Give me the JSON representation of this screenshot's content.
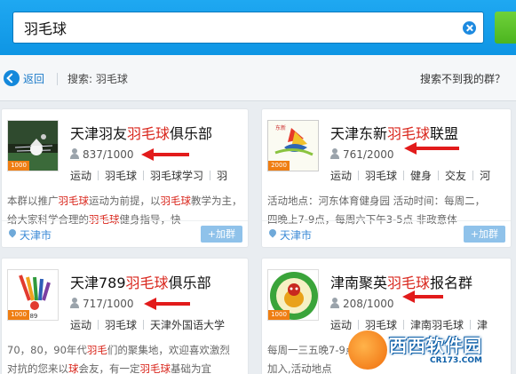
{
  "search": {
    "query": "羽毛球"
  },
  "nav": {
    "back": "返回",
    "search_label": "搜索: 羽毛球",
    "not_found": "搜索不到我的群？"
  },
  "colors": {
    "accent": "#0e95e4",
    "highlight": "#d9261c",
    "badge": "#ef7e13",
    "join": "#8fc2ea"
  },
  "groups": [
    {
      "title_pre": "天津羽友",
      "title_hl": "羽毛球",
      "title_post": "俱乐部",
      "members": "837/1000",
      "badge": "1000",
      "tags": [
        "运动",
        "羽毛球",
        "羽毛球学习",
        "羽"
      ],
      "desc1_a": "本群以推广",
      "desc1_hl1": "羽毛球",
      "desc1_b": "运动为前提，以",
      "desc1_hl2": "羽毛球",
      "desc1_c": "教学为主，",
      "desc2_a": "给大家科学合理的",
      "desc2_hl": "羽毛球",
      "desc2_b": "健身指导，快",
      "location": "天津市",
      "join": "+加群"
    },
    {
      "title_pre": "天津东新",
      "title_hl": "羽毛球",
      "title_post": "联盟",
      "members": "761/2000",
      "badge": "2000",
      "tags": [
        "运动",
        "羽毛球",
        "健身",
        "交友",
        "河"
      ],
      "desc1": "活动地点：河东体育健身园 活动时间：每周二，",
      "desc2": "四晚上7-9点，每周六下午3-5点 非政意体",
      "location": "天津市",
      "join": "+加群"
    },
    {
      "title_pre": "天津789",
      "title_hl": "羽毛球",
      "title_post": "俱乐部",
      "members": "717/1000",
      "badge": "1000",
      "tags": [
        "运动",
        "羽毛球",
        "天津外国语大学"
      ],
      "desc1_a": "70，80，90年代",
      "desc1_hl": "羽毛",
      "desc1_b": "们的聚集地，欢迎喜欢激烈",
      "desc2_a": "对抗的您来以",
      "desc2_hl1": "球",
      "desc2_b": "会友，有一定",
      "desc2_hl2": "羽毛球",
      "desc2_c": "基础为宜"
    },
    {
      "title_pre": "津南聚英",
      "title_hl": "羽毛球",
      "title_post": "报名群",
      "members": "208/1000",
      "badge": "1000",
      "tags": [
        "运动",
        "羽毛球",
        "津南羽毛球",
        "津"
      ],
      "desc1": "每周一三五晚7-9点",
      "desc2": "加入,活动地点"
    }
  ],
  "watermark": {
    "title": "西西软件园",
    "sub": "CR173.COM"
  }
}
